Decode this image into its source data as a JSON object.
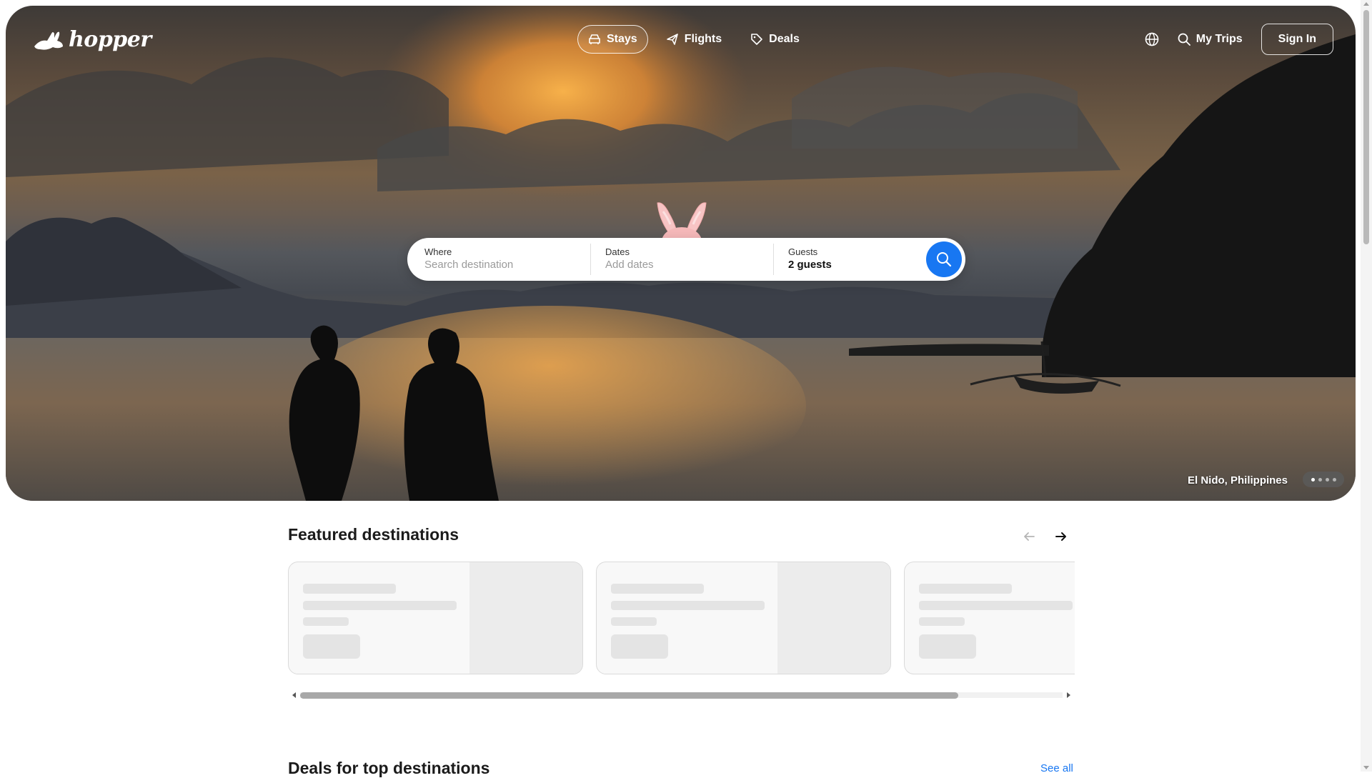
{
  "header": {
    "logo_text": "hopper",
    "tabs": [
      {
        "label": "Stays",
        "active": true,
        "icon": "car-icon"
      },
      {
        "label": "Flights",
        "active": false,
        "icon": "plane-icon"
      },
      {
        "label": "Deals",
        "active": false,
        "icon": "tag-icon"
      }
    ],
    "my_trips_label": "My Trips",
    "sign_in_label": "Sign In"
  },
  "search": {
    "where_label": "Where",
    "where_placeholder": "Search destination",
    "dates_label": "Dates",
    "dates_placeholder": "Add dates",
    "guests_label": "Guests",
    "guests_value": "2 guests"
  },
  "hero": {
    "caption": "El Nido, Philippines",
    "slide_count": 4,
    "active_slide": 1
  },
  "featured": {
    "title": "Featured destinations",
    "cards_loading": 3
  },
  "deals": {
    "title": "Deals for top destinations",
    "see_all_label": "See all"
  },
  "colors": {
    "accent": "#1877f2",
    "skeleton": "#e4e4e4"
  }
}
